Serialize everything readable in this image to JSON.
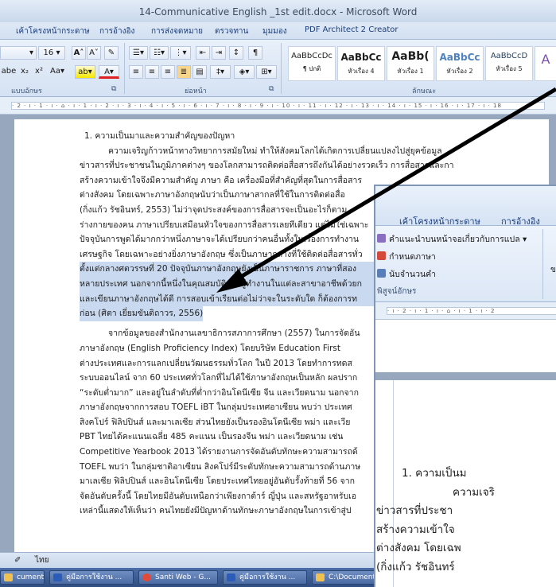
{
  "window": {
    "title": "14-Communicative English _1st edit.docx - Microsoft Word"
  },
  "menu_tabs": [
    "เค้าโครงหน้ากระดาษ",
    "การอ้างอิง",
    "การส่งจดหมาย",
    "ตรวจทาน",
    "มุมมอง",
    "PDF Architect 2 Creator"
  ],
  "ribbon": {
    "font_size": "16",
    "group_font": "แบบอักษร",
    "group_paragraph": "ย่อหน้า",
    "group_styles": "ลักษณะ",
    "styles": [
      {
        "sample": "AaBbCcDc",
        "name": "¶ ปกติ"
      },
      {
        "sample": "AaBbCc",
        "name": "หัวเรื่อง 4"
      },
      {
        "sample": "AaBb(",
        "name": "หัวเรื่อง 1"
      },
      {
        "sample": "AaBbCc",
        "name": "หัวเรื่อง 2"
      },
      {
        "sample": "AaBbCcD",
        "name": "หัวเรื่อง 5"
      }
    ]
  },
  "ruler_text": "· 2 · ı · 1 · ı · ⌂ · ı · 1 · ı · 2 · ı · 3 · ı · 4 · ı · 5 · ı · 6 · ı · 7 · ı · 8 · ı · 9 · ı · 10 · ı · 11 · ı · 12 · ı · 13 · ı · 14 · ı · 15 · ı · 16 · ı · 17 · ı · 18",
  "document": {
    "heading": "1.  ความเป็นมาและความสำคัญของปัญหา",
    "lines": [
      "ความเจริญก้าวหน้าทางวิทยาการสมัยใหม่ ทำให้สังคมโลกได้เกิดการเปลี่ยนแปลงไปสู่ยุคข้อมูล",
      "ข่าวสารที่ประชาชนในภูมิภาคต่างๆ ของโลกสามารถติดต่อสื่อสารถึงกันได้อย่างรวดเร็ว การสื่อสารและการ",
      "สร้างความเข้าใจจึงมีความสำคัญ ภาษา คือ เครื่องมือที่สำคัญที่สุดในการสื่อสาร",
      "ต่างสังคม โดยเฉพาะภาษาอังกฤษนับว่าเป็นภาษาสากลที่ใช้ในการติดต่อสื่อ",
      "(กิ่งแก้ว รัชอินทร์, 2553) ไม่ว่าจุดประสงค์ของการสื่อสารจะเป็นอะไรก็ตาม",
      "ร่างกายของคน ภาษาเปรียบเสมือนหัวใจของการสื่อสารเลยทีเดียว แต่ไม่ใช่เฉพาะ",
      "ปัจจุบันการพูดได้มากกว่าหนึ่งภาษาจะได้เปรียบกว่าคนอื่นทั้งในเรื่องการทำงาน",
      "เศรษฐกิจ โดยเฉพาะอย่างยิ่งภาษาอังกฤษ ซึ่งเป็นภาษากลางที่ใช้ติดต่อสื่อสารทั่ว",
      "ตั้งแต่กลางศตวรรษที่ 20 ปัจจุบันภาษาอังกฤษยังเป็นภาษาราชการ ภาษาที่สอง",
      "หลายประเทศ นอกจากนี้หนึ่งในคุณสมบัติของผู้ทำงานในแต่ละสาขาอาชีพด้วยก",
      "และเขียนภาษาอังกฤษได้ดี การสอบเข้าเรียนต่อไม่ว่าจะในระดับใด ก็ต้องการท",
      "ก่อน (ศิตา เยี่ยมขันติถาวร, 2556)",
      "จากข้อมูลของสำนักงานเลขาธิการสภาการศึกษา (2557) ในการจัดอัน",
      "ภาษาอังกฤษ (English Proficiency Index) โดยบริษัท Education First",
      "ต่างประเทศและการแลกเปลี่ยนวัฒนธรรมทั่วโลก ในปี 2013 โดยทำการทดส",
      "ระบบออนไลน์ จาก 60 ประเทศทั่วโลกที่ไม่ได้ใช้ภาษาอังกฤษเป็นหลัก ผลปราก",
      "“ระดับต่ำมาก” และอยู่ในลำดับที่ต่ำกว่าอินโดนีเซีย จีน และเวียดนาม นอกจาก",
      "ภาษาอังกฤษจากการสอบ TOEFL iBT ในกลุ่มประเทศอาเซียน พบว่า ประเทศ",
      "สิงคโปร์ ฟิลิปปินส์ และมาเลเซีย ส่วนไทยยังเป็นรองอินโดนีเซีย พม่า และเวีย",
      "PBT ไทยได้คะแนนเฉลี่ย 485 คะแนน เป็นรองจีน พม่า และเวียดนาม เช่น",
      "Competitive Yearbook 2013 ได้รายงานการจัดอันดับทักษะความสามารถด้",
      "TOEFL พบว่า ในกลุ่มชาติอาเซียน สิงคโปร์มีระดับทักษะความสามารถด้านภาษ",
      "มาเลเซีย ฟิลิปปินส์ และอินโดนีเซีย โดยประเทศไทยอยู่อันดับรั้งท้ายที่ 56 จาก",
      "จัดอันดับครั้งนี้ โดยไทยมีอันดับเหนือกว่าเพียงกาต้าร์ ญี่ปุ่น และสหรัฐอาหรับเอ",
      "เหล่านี้แสดงให้เห็นว่า คนไทยยังมีปัญหาด้านทักษะภาษาอังกฤษในการเข้าสู่ป"
    ]
  },
  "statusbar": {
    "language": "ไทย"
  },
  "taskbar": [
    {
      "label": "cuments ...",
      "color": "#f0c050"
    },
    {
      "label": "คู่มือการใช้งาน ...",
      "color": "#2a5cb8"
    },
    {
      "label": "Santi Web - G...",
      "color": "#e24b3a"
    },
    {
      "label": "คู่มือการใช้งาน ...",
      "color": "#2a5cb8"
    },
    {
      "label": "C:\\Documents ...",
      "color": "#f0c050"
    }
  ],
  "overlay": {
    "tabs": [
      "เค้าโครงหน้ากระดาษ",
      "การอ้างอิง"
    ],
    "items": [
      "คำแนะนำบนหน้าจอเกี่ยวกับการแปล",
      "กำหนดภาษา",
      "นับจำนวนคำ"
    ],
    "group_label": "พิสูจน์อักษร",
    "ruler_text": "· ı · 2 · ı · 1 · ı · ⌂ · ı · 1 · ı · 2",
    "lines": [
      "1.  ความเป็นม",
      "ความเจริ",
      "ข่าวสารที่ประชา",
      "สร้างความเข้าใจ",
      "ต่างสังคม โดยเฉพ",
      "(กิ่งแก้ว รัชอินทร์"
    ]
  }
}
